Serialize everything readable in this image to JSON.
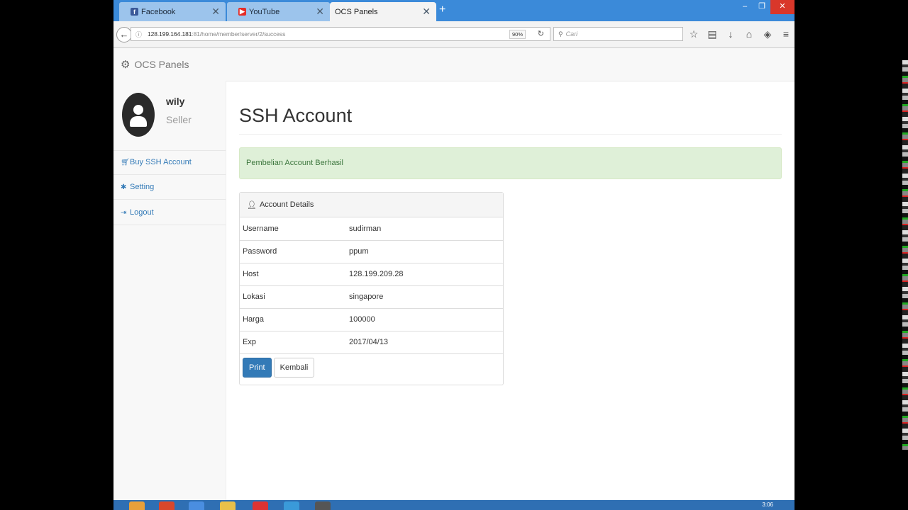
{
  "browser": {
    "tabs": [
      {
        "label": "Facebook",
        "icon": "facebook-icon",
        "active": false
      },
      {
        "label": "YouTube",
        "icon": "youtube-icon",
        "active": false
      },
      {
        "label": "OCS Panels",
        "icon": "",
        "active": true
      }
    ],
    "url_main": "128.199.164.181",
    "url_rest": ":81/home/member/server/2/success",
    "zoom": "90%",
    "search_placeholder": "Cari"
  },
  "app": {
    "brand": "OCS Panels"
  },
  "user": {
    "name": "wily",
    "role": "Seller"
  },
  "sidebar": {
    "items": [
      {
        "label": "Buy SSH Account",
        "icon": "cart-icon"
      },
      {
        "label": "Setting",
        "icon": "gear-icon"
      },
      {
        "label": "Logout",
        "icon": "logout-icon"
      }
    ]
  },
  "page": {
    "title": "SSH Account",
    "alert": "Pembelian Account Berhasil",
    "panel_title": "Account Details",
    "rows": [
      {
        "key": "Username",
        "value": "sudirman"
      },
      {
        "key": "Password",
        "value": "ppum"
      },
      {
        "key": "Host",
        "value": "128.199.209.28"
      },
      {
        "key": "Lokasi",
        "value": "singapore"
      },
      {
        "key": "Harga",
        "value": "100000"
      },
      {
        "key": "Exp",
        "value": "2017/04/13"
      }
    ],
    "print_label": "Print",
    "back_label": "Kembali"
  },
  "taskbar": {
    "clock": "3:06"
  },
  "colors": {
    "tabbar": "#3b8ad9",
    "primary": "#337ab7",
    "success_bg": "#dff0d8",
    "success_text": "#3c763d"
  }
}
